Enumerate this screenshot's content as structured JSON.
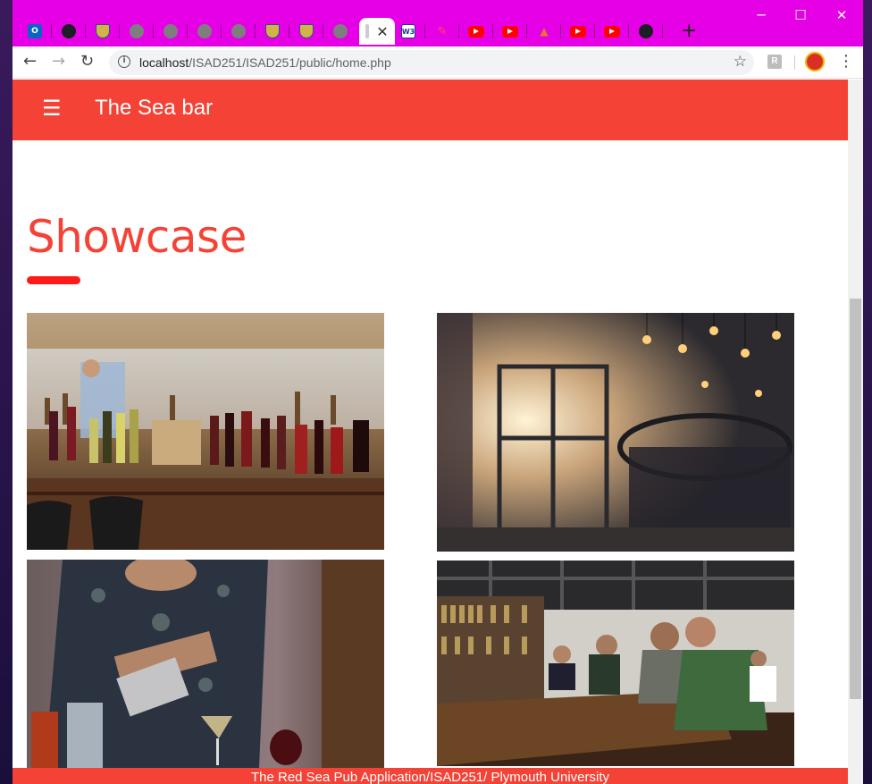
{
  "browser": {
    "tabs": [
      {
        "icon": "outlook-icon",
        "title": ""
      },
      {
        "icon": "github-icon",
        "title": ""
      },
      {
        "icon": "university-shield-icon",
        "title": ""
      },
      {
        "icon": "globe-icon",
        "title": ""
      },
      {
        "icon": "globe-icon",
        "title": ""
      },
      {
        "icon": "globe-icon",
        "title": ""
      },
      {
        "icon": "globe-icon",
        "title": ""
      },
      {
        "icon": "university-shield-icon",
        "title": ""
      },
      {
        "icon": "university-shield-icon",
        "title": ""
      },
      {
        "icon": "globe-icon",
        "title": ""
      },
      {
        "icon": "page-icon",
        "title": "",
        "active": true
      },
      {
        "icon": "w3schools-icon",
        "title": ""
      },
      {
        "icon": "books-icon",
        "title": ""
      },
      {
        "icon": "youtube-icon",
        "title": ""
      },
      {
        "icon": "youtube-icon",
        "title": ""
      },
      {
        "icon": "ship-icon",
        "title": ""
      },
      {
        "icon": "youtube-icon",
        "title": ""
      },
      {
        "icon": "youtube-icon",
        "title": ""
      },
      {
        "icon": "github-icon",
        "title": ""
      }
    ],
    "w3_label": "W3",
    "active_tab_close": "✕",
    "new_tab": "+",
    "window_controls": {
      "minimize": "─",
      "maximize": "☐",
      "close": "✕"
    },
    "url_host": "localhost",
    "url_path": "/ISAD251/ISAD251/public/home.php",
    "info_glyph": "i",
    "extension_label": "R",
    "tab_strip_color": "#e600e6"
  },
  "app": {
    "menu_icon": "☰",
    "brand": "The Sea bar",
    "accent": "#f44336",
    "section_title": "Showcase",
    "photos": [
      {
        "name": "bar-counter-bottles-photo"
      },
      {
        "name": "bar-interior-window-photo"
      },
      {
        "name": "bartender-pouring-photo"
      },
      {
        "name": "bar-patrons-photo"
      }
    ],
    "footer": "The Red Sea Pub Application/ISAD251/ Plymouth University"
  }
}
